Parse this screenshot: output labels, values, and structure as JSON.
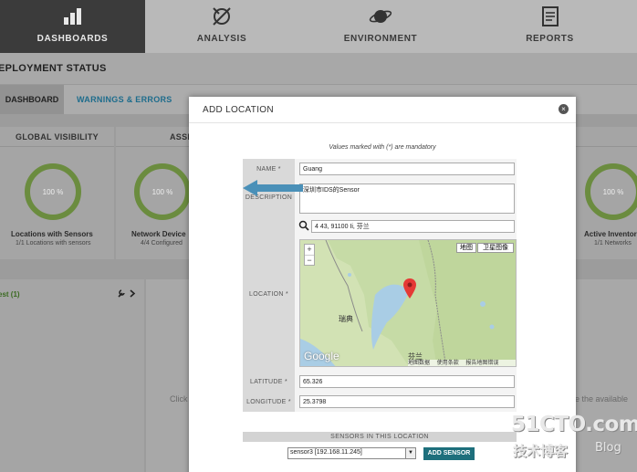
{
  "nav": {
    "tabs": [
      {
        "label": "DASHBOARDS",
        "icon": "bar-chart-icon"
      },
      {
        "label": "ANALYSIS",
        "icon": "satellite-icon"
      },
      {
        "label": "ENVIRONMENT",
        "icon": "planet-icon"
      },
      {
        "label": "REPORTS",
        "icon": "report-icon"
      }
    ],
    "active": "DASHBOARDS"
  },
  "page": {
    "title": "EPLOYMENT STATUS",
    "tabs": [
      "DASHBOARD",
      "WARNINGS & ERRORS"
    ]
  },
  "widgets": {
    "global_visibility": {
      "header": "GLOBAL VISIBILITY",
      "percent": "100 %",
      "label": "Locations with Sensors",
      "sub": "1/1 Locations with sensors"
    },
    "assets": {
      "header": "ASSE",
      "percent": "100 %",
      "label": "Network Device",
      "sub": "4/4 Configured"
    },
    "inventory": {
      "percent": "100 %",
      "label": "Active Inventor",
      "sub": "1/1 Networks"
    }
  },
  "lower": {
    "left_title": "est (1)",
    "click_hint": "Click",
    "available_hint": "e the available"
  },
  "modal": {
    "title": "ADD LOCATION",
    "close": "×",
    "mandatory_note": "Values marked with (*) are mandatory",
    "fields": {
      "name": {
        "label": "NAME *",
        "value": "Guang"
      },
      "description": {
        "label": "DESCRIPTION",
        "value": "深圳市IDS的Sensor"
      },
      "location": {
        "label": "LOCATION *",
        "search_value": "4 43, 91100 Ii, 芬兰"
      },
      "latitude": {
        "label": "LATITUDE *",
        "value": "65.326"
      },
      "longitude": {
        "label": "LONGITUDE *",
        "value": "25.3798"
      }
    },
    "map": {
      "type_map": "地图",
      "type_satellite": "卫星图像",
      "zoom_in": "+",
      "zoom_out": "−",
      "label_sweden": "瑞典",
      "label_finland": "芬兰",
      "google": "Google",
      "footer_data": "地图数据",
      "footer_terms": "使用条款",
      "footer_report": "报告地图错误"
    },
    "sensors": {
      "header": "SENSORS IN THIS LOCATION",
      "selected": "sensor3 [192.168.11.245]",
      "add_button": "ADD SENSOR"
    }
  },
  "watermark": {
    "main": "51CTO.com",
    "sub": "技术博客",
    "blog": "Blog"
  },
  "colors": {
    "ring": "#6b8c3f",
    "accent": "#1e6f7c",
    "arrow": "#4a90b8"
  }
}
